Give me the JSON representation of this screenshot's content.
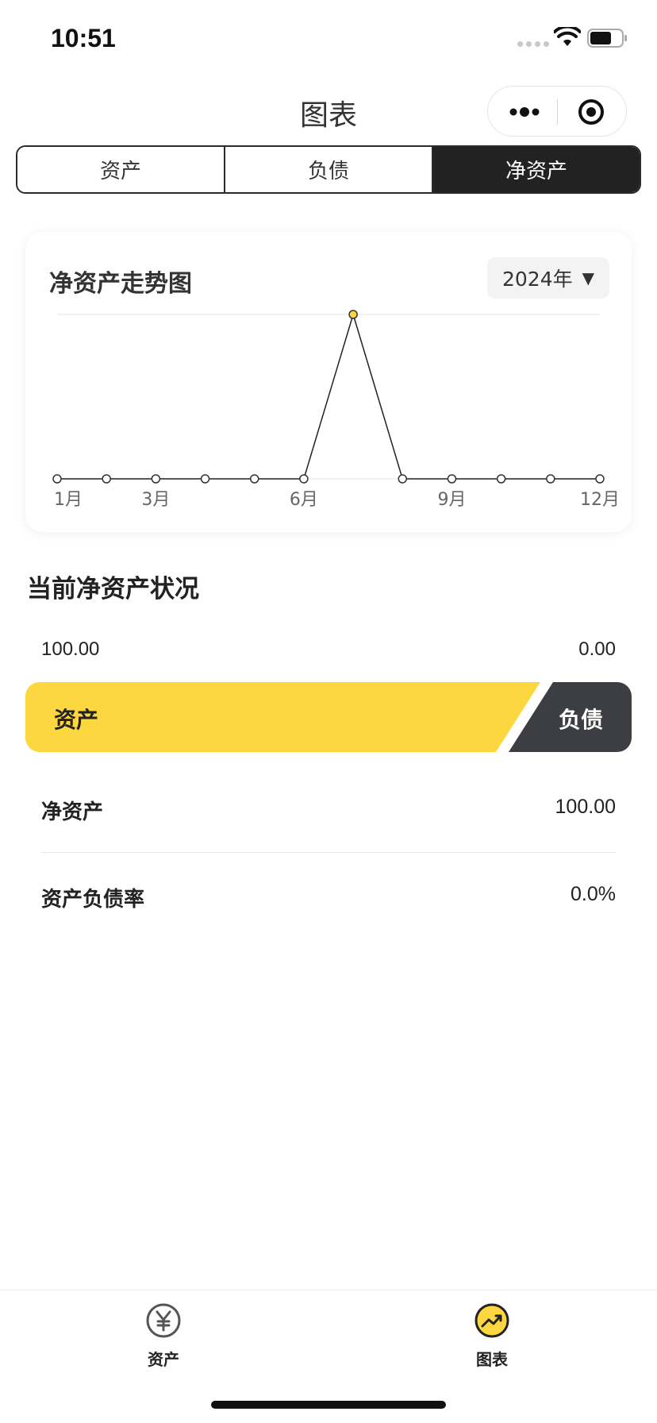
{
  "status_bar": {
    "time": "10:51"
  },
  "nav": {
    "title": "图表"
  },
  "tabs": [
    {
      "label": "资产",
      "active": false
    },
    {
      "label": "负债",
      "active": false
    },
    {
      "label": "净资产",
      "active": true
    }
  ],
  "chart_card": {
    "title": "净资产走势图",
    "year_select": "2024年",
    "caret": "▼"
  },
  "chart_data": {
    "type": "line",
    "title": "净资产走势图",
    "x": [
      "1月",
      "2月",
      "3月",
      "4月",
      "5月",
      "6月",
      "7月",
      "8月",
      "9月",
      "10月",
      "11月",
      "12月"
    ],
    "tick_labels": [
      "1月",
      "3月",
      "6月",
      "9月",
      "12月"
    ],
    "tick_indices": [
      0,
      2,
      5,
      8,
      11
    ],
    "series": [
      {
        "values": [
          0,
          0,
          0,
          0,
          0,
          0,
          100,
          0,
          0,
          0,
          0,
          0
        ]
      }
    ],
    "highlight_index": 6,
    "ylim": [
      0,
      100
    ],
    "grid": true,
    "line_color": "#222222",
    "highlight_color": "#fdd73f"
  },
  "summary": {
    "title": "当前净资产状况",
    "asset_value": "100.00",
    "liability_value": "0.00",
    "asset_label": "资产",
    "liability_label": "负债",
    "asset_ratio": 0.85,
    "net_asset_label": "净资产",
    "net_asset_value": "100.00",
    "debt_ratio_label": "资产负债率",
    "debt_ratio_value": "0.0%"
  },
  "tabbar": {
    "items": [
      {
        "label": "资产",
        "icon": "yen-icon"
      },
      {
        "label": "图表",
        "icon": "trend-chart-icon",
        "active": true
      }
    ]
  },
  "colors": {
    "accent": "#fdd73f",
    "dark": "#222222",
    "liability": "#3c3e43"
  }
}
